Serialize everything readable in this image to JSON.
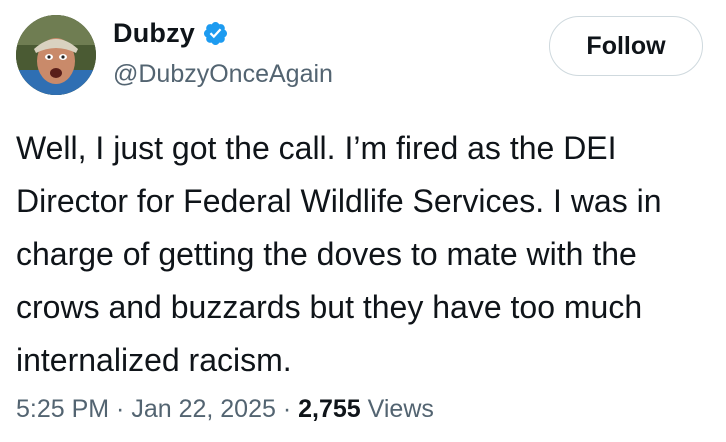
{
  "user": {
    "display_name": "Dubzy",
    "handle": "@DubzyOnceAgain",
    "verified_icon": "verified-badge-icon",
    "verified_color": "#1d9bf0"
  },
  "follow_button": {
    "label": "Follow"
  },
  "tweet": {
    "lines": [
      "Well, I just got the call. I’m fired as the DEI",
      "Director for Federal Wildlife Services. I was in",
      "charge of getting the doves to mate with the",
      "crows and buzzards but they have too much",
      "internalized racism."
    ]
  },
  "meta": {
    "time": "5:25 PM",
    "separator_1": " · ",
    "date": "Jan 22, 2025",
    "separator_2": " · ",
    "views_count": "2,755",
    "views_label": " Views"
  }
}
